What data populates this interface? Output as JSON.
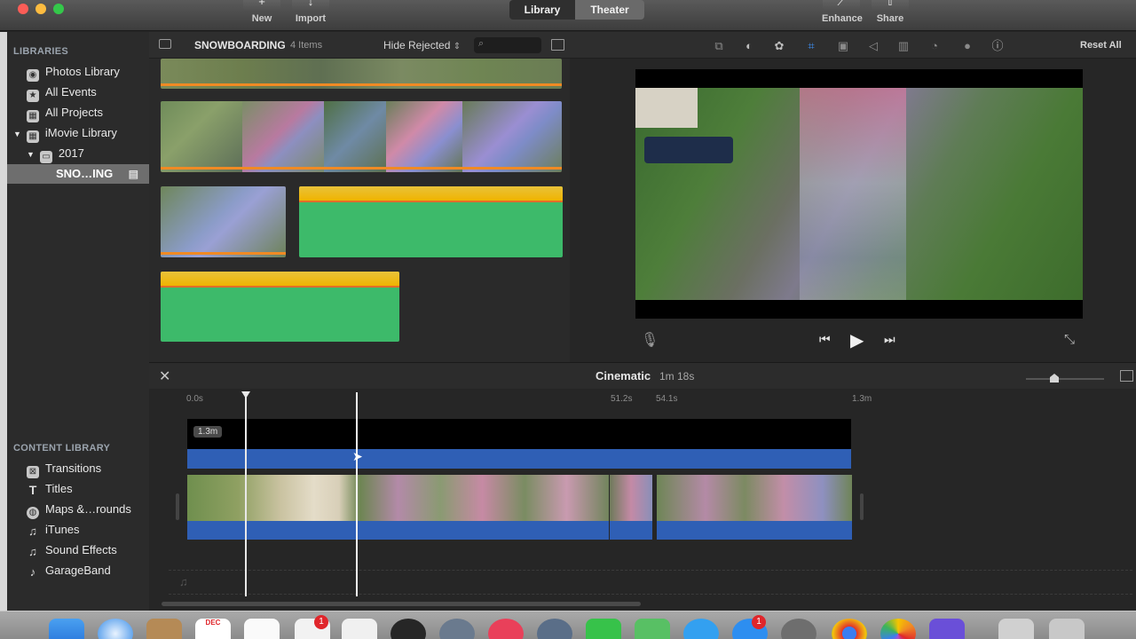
{
  "toolbar": {
    "new_label": "New",
    "import_label": "Import",
    "library_tab": "Library",
    "theater_tab": "Theater",
    "enhance_label": "Enhance",
    "share_label": "Share"
  },
  "sidebar": {
    "libraries_header": "LIBRARIES",
    "items": [
      {
        "label": "Photos Library",
        "icon": "photos-icon"
      },
      {
        "label": "All Events",
        "icon": "star-icon"
      },
      {
        "label": "All Projects",
        "icon": "grid-icon"
      },
      {
        "label": "iMovie Library",
        "icon": "grid-icon"
      },
      {
        "label": "2017",
        "icon": "folder-icon"
      },
      {
        "label": "SNO…ING",
        "icon": "clapper-icon"
      }
    ],
    "content_header": "CONTENT LIBRARY",
    "content_items": [
      {
        "label": "Transitions",
        "icon": "transitions-icon"
      },
      {
        "label": "Titles",
        "icon": "titles-icon"
      },
      {
        "label": "Maps &…rounds",
        "icon": "globe-icon"
      },
      {
        "label": "iTunes",
        "icon": "music-icon"
      },
      {
        "label": "Sound Effects",
        "icon": "music-icon"
      },
      {
        "label": "GarageBand",
        "icon": "guitar-icon"
      }
    ]
  },
  "browser": {
    "event_name": "SNOWBOARDING",
    "item_count": "4 Items",
    "filter": "Hide Rejected"
  },
  "viewer": {
    "reset_label": "Reset All"
  },
  "timeline": {
    "project_title": "Cinematic",
    "duration": "1m 18s",
    "ticks": [
      "0.0s",
      "51.2s",
      "54.1s",
      "1.3m"
    ],
    "clip_duration_label": "1.3m"
  },
  "dock": {
    "calendar_month": "DEC",
    "badges": [
      "1",
      "1"
    ]
  },
  "colors": {
    "accent_blue": "#2f5fb5",
    "audio_green": "#3dba6a",
    "audio_yellow": "#f0c020",
    "selection_orange": "#f08a24"
  }
}
